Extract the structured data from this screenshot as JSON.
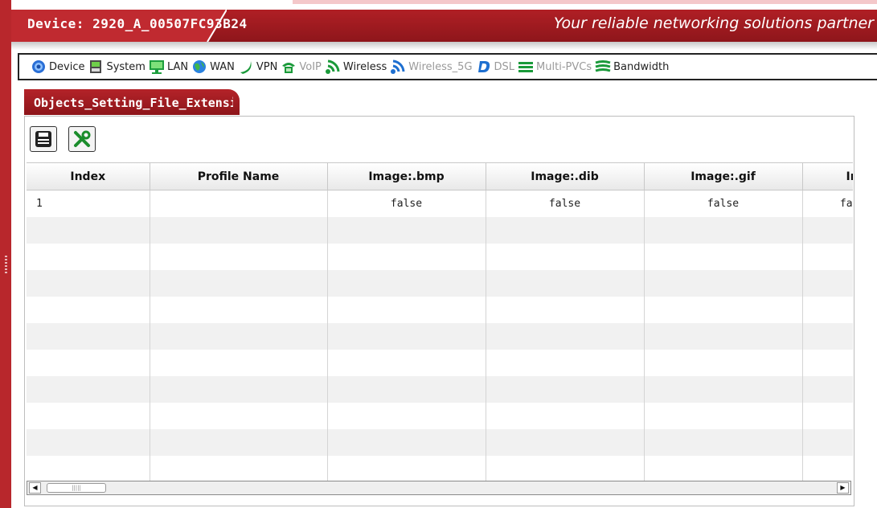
{
  "header": {
    "device_title": "Device: 2920_A_00507FC93B24",
    "slogan": "Your reliable networking solutions partner"
  },
  "menu": {
    "items": [
      {
        "label": "Device",
        "icon": "device-icon",
        "enabled": true
      },
      {
        "label": "System",
        "icon": "system-icon",
        "enabled": true
      },
      {
        "label": "LAN",
        "icon": "lan-icon",
        "enabled": true
      },
      {
        "label": "WAN",
        "icon": "wan-globe-icon",
        "enabled": true
      },
      {
        "label": "VPN",
        "icon": "vpn-icon",
        "enabled": true
      },
      {
        "label": "VoIP",
        "icon": "voip-phone-icon",
        "enabled": false
      },
      {
        "label": "Wireless",
        "icon": "wireless-icon",
        "enabled": true
      },
      {
        "label": "Wireless_5G",
        "icon": "wireless-5g-icon",
        "enabled": false
      },
      {
        "label": "DSL",
        "icon": "dsl-icon",
        "enabled": false
      },
      {
        "label": "Multi-PVCs",
        "icon": "multi-pvcs-icon",
        "enabled": false
      },
      {
        "label": "Bandwidth",
        "icon": "bandwidth-icon",
        "enabled": true
      }
    ]
  },
  "panel": {
    "tab_title": "Objects_Setting_File_Extension"
  },
  "toolbar": {
    "save_icon": "save-icon",
    "tools_icon": "tools-icon"
  },
  "table": {
    "columns": [
      "Index",
      "Profile Name",
      "Image:.bmp",
      "Image:.dib",
      "Image:.gif",
      "Image:.jpeg"
    ],
    "rows": [
      [
        "1",
        "",
        "false",
        "false",
        "false",
        "false"
      ]
    ]
  },
  "colors": {
    "brand_red": "#b01f25",
    "menu_green": "#1a9a3a",
    "menu_blue": "#1e6fd0"
  }
}
